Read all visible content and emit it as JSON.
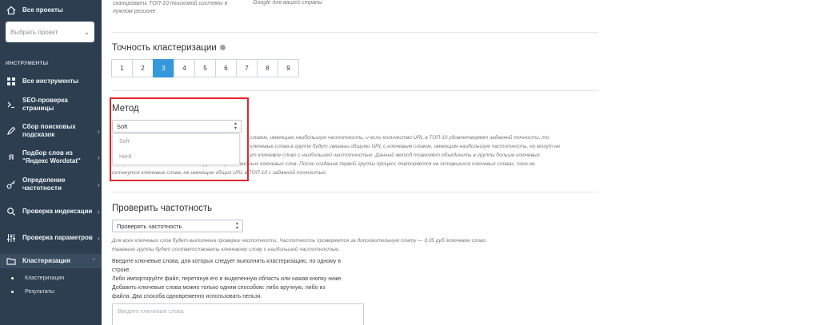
{
  "sidebar": {
    "all_projects": "Все проекты",
    "project_placeholder": "Выбрать проект",
    "section": "ИНСТРУМЕНТЫ",
    "items": [
      {
        "label": "Все инструменты",
        "icon": "grid-icon"
      },
      {
        "label": "SEO-проверка страницы",
        "icon": "terminal-icon"
      },
      {
        "label": "Сбор поисковых подсказок",
        "icon": "pencil-icon"
      },
      {
        "label": "Подбор слов из \"Яндекс Wordstat\"",
        "icon": "yandex-icon"
      },
      {
        "label": "Определение частотности",
        "icon": "key-icon"
      },
      {
        "label": "Проверка индексации",
        "icon": "search-icon"
      },
      {
        "label": "Проверка параметров",
        "icon": "sliders-icon"
      },
      {
        "label": "Кластеризация",
        "icon": "folder-icon"
      }
    ],
    "sub_items": [
      "Кластеризация",
      "Результаты"
    ]
  },
  "main": {
    "top_note_1_line1": "сканировать ТОП-10 поисковой системы в",
    "top_note_1_line2": "нужном регионе",
    "top_note_2": "Google для вашей страны",
    "accuracy_title": "Точность кластеризации",
    "accuracy_options": [
      "1",
      "2",
      "3",
      "4",
      "5",
      "6",
      "7",
      "8",
      "9"
    ],
    "accuracy_selected": "3",
    "method_title": "Метод",
    "method_value": "Soft",
    "method_options": [
      "Soft",
      "Hard"
    ],
    "method_desc_lines": [
      "словом, имеющим наибольшую частотность, и если количество URL в ТОП-10 удовлетворяет заданной точности, то",
      "ключевые слова в группе будут связаны общими URL с ключевым словом, имеющим наибольшую частотность, но могут не",
      "ут ключевое слово с наибольшей частотностью. Данный метод позволяет объединить в группы больше ключевых",
      "слов, но не исключает попадания в группы нерелевантных ключевых слов. После создания первой группы процесс повторяется на оставшихся ключевых словах, пока не",
      "останутся ключевые слова, не имеющие общих URL в ТОП-10 с заданной точностью."
    ],
    "freq_title": "Проверить частотность",
    "freq_value": "Проверять частотность",
    "freq_desc_line1": "Для всех ключевых слов будет выполнена проверка частотности. Частотность проверяется за дополнительную плату — 0.05 руб./ключевое слово.",
    "freq_desc_line2": "Название группы будет соответствовать ключевому слову с наибольшей частотностью.",
    "instructions": [
      "Введите ключевые слова, для которых следует выполнить кластеризацию, по одному в",
      "строке.",
      "Либо импортируйте файл, перетянув его в выделенную область или нажав кнопку ниже.",
      "Добавить ключевые слова можно только одним способом: либо вручную, либо из",
      "файла. Два способа одновременно использовать нельзя."
    ],
    "keywords_placeholder": "Введите ключевые слова"
  }
}
